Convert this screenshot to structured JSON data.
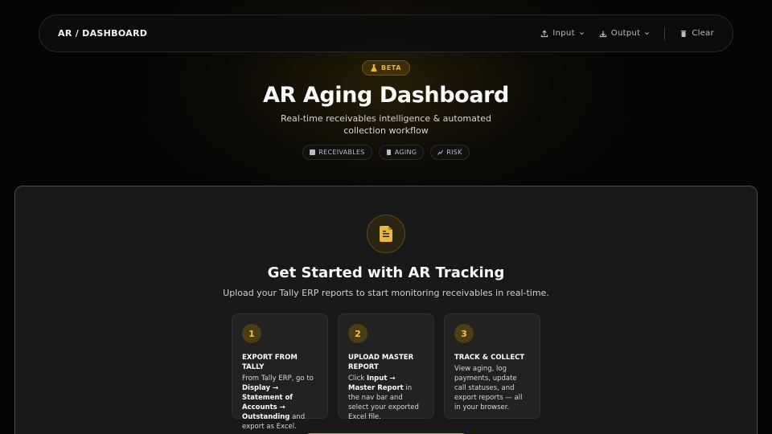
{
  "nav": {
    "brand": "AR / DASHBOARD",
    "input_label": "Input",
    "output_label": "Output",
    "clear_label": "Clear"
  },
  "hero": {
    "badge": "BETA",
    "title": "AR Aging Dashboard",
    "subtitle": "Real-time receivables intelligence & automated collection workflow",
    "tags": [
      "RECEIVABLES",
      "AGING",
      "RISK"
    ]
  },
  "panel": {
    "title": "Get Started with AR Tracking",
    "subtitle": "Upload your Tally ERP reports to start monitoring receivables in real-time.",
    "steps": [
      {
        "number": "1",
        "title": "EXPORT FROM TALLY",
        "desc_pre": "From Tally ERP, go to ",
        "desc_bold": "Display → Statement of Accounts → Outstanding",
        "desc_post": " and export as Excel."
      },
      {
        "number": "2",
        "title": "UPLOAD MASTER REPORT",
        "desc_pre": "Click ",
        "desc_bold": "Input → Master Report",
        "desc_post": " in the nav bar and select your exported Excel file."
      },
      {
        "number": "3",
        "title": "TRACK & COLLECT",
        "desc_pre": "View aging, log payments, update call statuses, and export reports — all in your browser.",
        "desc_bold": "",
        "desc_post": ""
      }
    ]
  },
  "colors": {
    "accent": "#e8b83a",
    "background": "#050505",
    "panel": "#191919"
  },
  "icons": {
    "input": "upload-icon",
    "output": "download-icon",
    "clear": "trash-icon",
    "beta": "flask-icon",
    "panel": "document-icon"
  }
}
